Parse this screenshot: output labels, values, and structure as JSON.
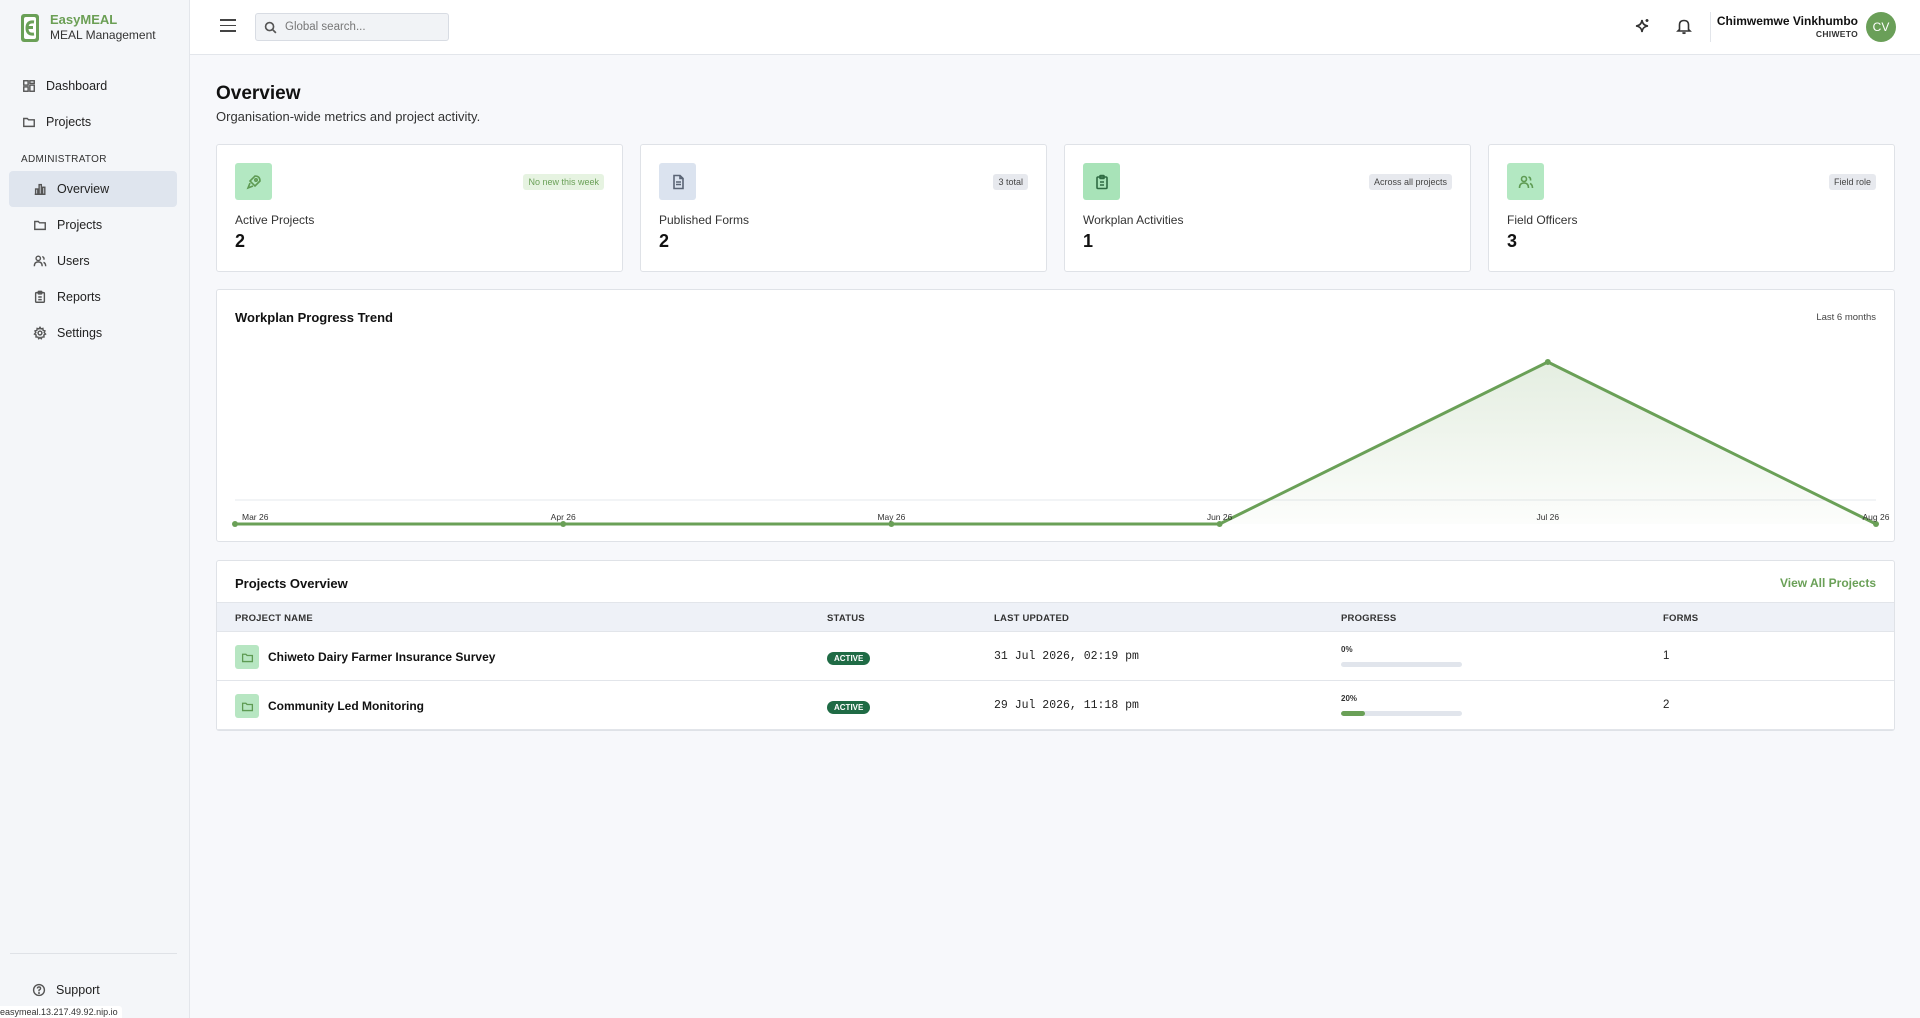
{
  "brand": {
    "name": "EasyMEAL",
    "subtitle": "MEAL Management"
  },
  "sidebar": {
    "main_items": [
      {
        "label": "Dashboard",
        "icon": "grid-icon"
      },
      {
        "label": "Projects",
        "icon": "folder-icon"
      }
    ],
    "section_label": "ADMINISTRATOR",
    "admin_items": [
      {
        "label": "Overview",
        "icon": "bar-chart-icon",
        "active": true
      },
      {
        "label": "Projects",
        "icon": "folder-icon"
      },
      {
        "label": "Users",
        "icon": "users-icon"
      },
      {
        "label": "Reports",
        "icon": "clipboard-icon"
      },
      {
        "label": "Settings",
        "icon": "gear-icon"
      }
    ],
    "support_label": "Support"
  },
  "statusbar": {
    "url": "easymeal.13.217.49.92.nip.io"
  },
  "topbar": {
    "search_placeholder": "Global search...",
    "user_name": "Chimwemwe Vinkhumbo",
    "user_org": "CHIWETO",
    "avatar_initials": "CV"
  },
  "page": {
    "title": "Overview",
    "subtitle": "Organisation-wide metrics and project activity."
  },
  "stats": [
    {
      "label": "Active Projects",
      "value": "2",
      "badge": "No new this week",
      "badge_style": "green",
      "icon": "rocket-icon",
      "icon_bg": "#b3e8c2",
      "icon_stroke": "#5e9b53"
    },
    {
      "label": "Published Forms",
      "value": "2",
      "badge": "3 total",
      "badge_style": "gray",
      "icon": "document-icon",
      "icon_bg": "#dbe3ef",
      "icon_stroke": "#5a6475"
    },
    {
      "label": "Workplan Activities",
      "value": "1",
      "badge": "Across all projects",
      "badge_style": "gray",
      "icon": "clipboard-icon",
      "icon_bg": "#a8e3b8",
      "icon_stroke": "#2f6b43"
    },
    {
      "label": "Field Officers",
      "value": "3",
      "badge": "Field role",
      "badge_style": "gray",
      "icon": "users-icon",
      "icon_bg": "#b3e8c2",
      "icon_stroke": "#5e9b53"
    }
  ],
  "chart_data": {
    "type": "area",
    "title": "Workplan Progress Trend",
    "range_label": "Last 6 months",
    "categories": [
      "Mar 26",
      "Apr 26",
      "May 26",
      "Jun 26",
      "Jul 26",
      "Aug 26"
    ],
    "values": [
      0,
      0,
      0,
      0,
      1,
      0
    ],
    "ylim": [
      0,
      1
    ],
    "color": "#6aa057",
    "grid": false
  },
  "projects": {
    "title": "Projects Overview",
    "view_all_label": "View All Projects",
    "columns": [
      "PROJECT NAME",
      "STATUS",
      "LAST UPDATED",
      "PROGRESS",
      "FORMS"
    ],
    "rows": [
      {
        "name": "Chiweto Dairy Farmer Insurance Survey",
        "status": "ACTIVE",
        "last_updated": "31 Jul 2026, 02:19 pm",
        "progress_label": "0%",
        "progress": 0,
        "forms": "1"
      },
      {
        "name": "Community Led Monitoring",
        "status": "ACTIVE",
        "last_updated": "29 Jul 2026, 11:18 pm",
        "progress_label": "20%",
        "progress": 20,
        "forms": "2"
      }
    ]
  }
}
